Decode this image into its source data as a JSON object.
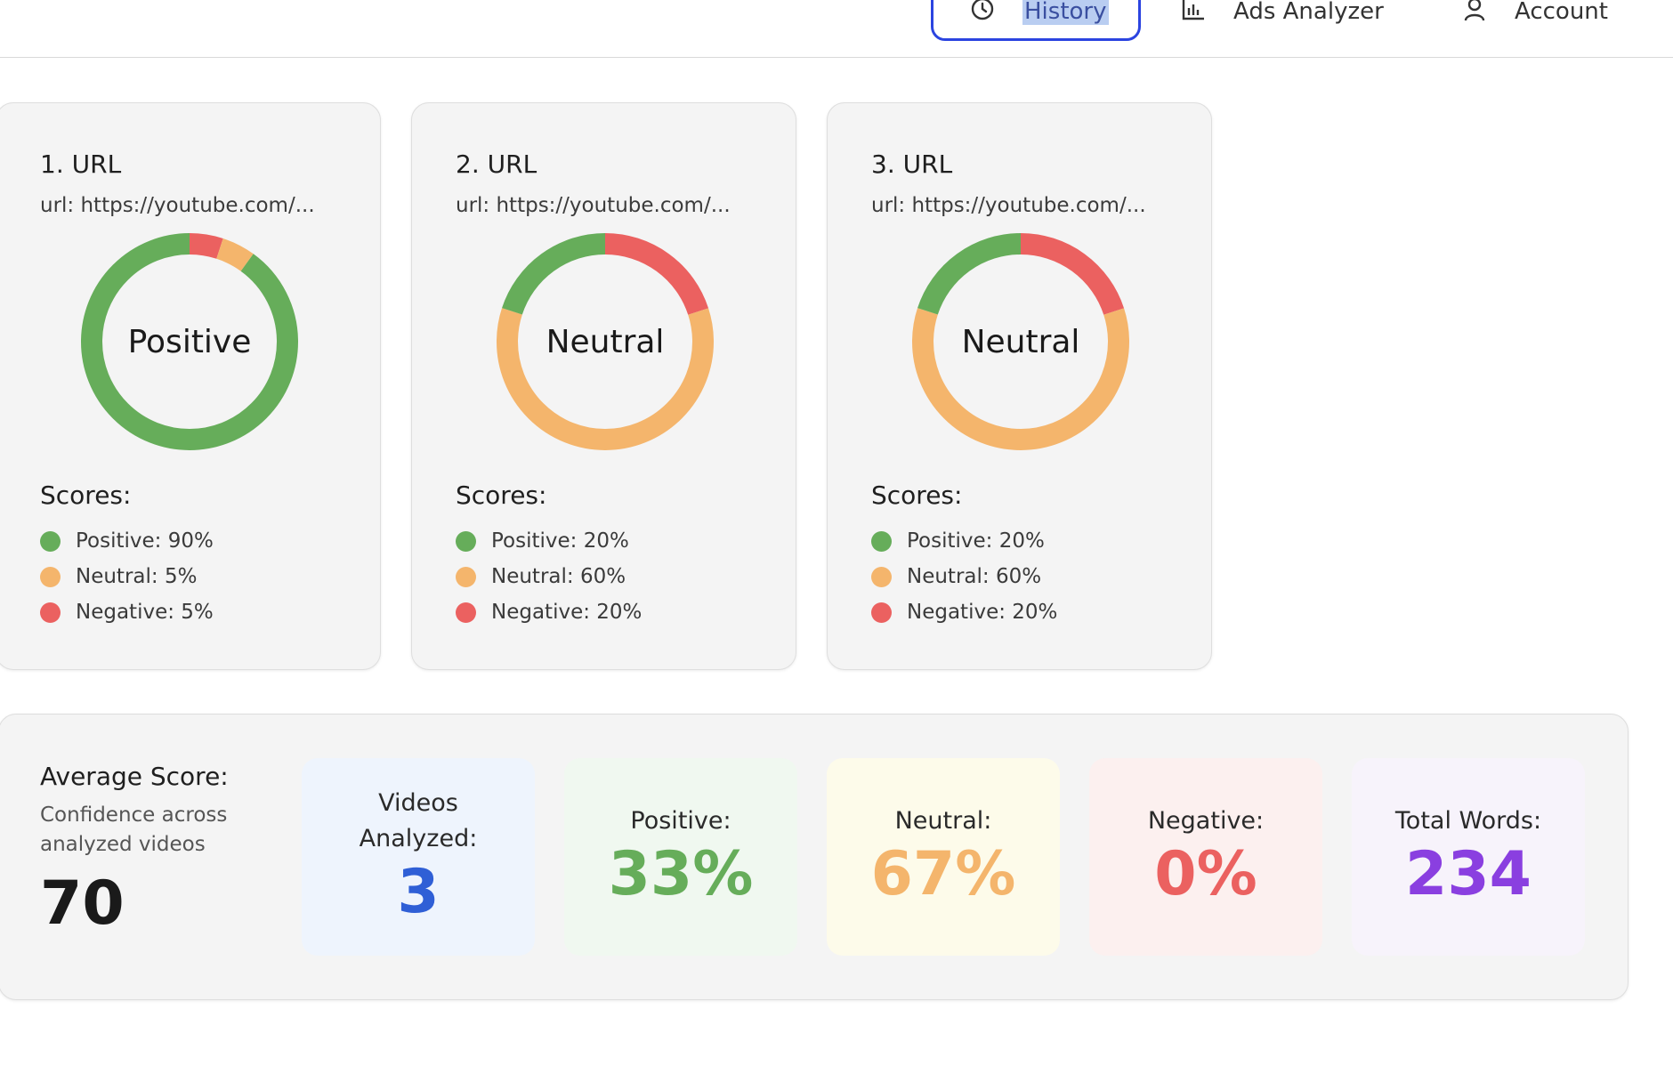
{
  "nav": {
    "history_label": "History",
    "ads_label": "Ads Analyzer",
    "account_label": "Account"
  },
  "colors": {
    "positive": "#66ad5a",
    "neutral": "#f4b56c",
    "negative": "#eb6160",
    "videos_blue": "#2f5fd6",
    "words_purple": "#8a3fe0"
  },
  "cards": [
    {
      "title": "1. URL",
      "url": "url: https://youtube.com/...",
      "center_label": "Positive",
      "scores_title": "Scores:",
      "positive": 90,
      "neutral": 5,
      "negative": 5,
      "positive_label": "Positive: 90%",
      "neutral_label": "Neutral: 5%",
      "negative_label": "Negative: 5%"
    },
    {
      "title": "2. URL",
      "url": "url: https://youtube.com/...",
      "center_label": "Neutral",
      "scores_title": "Scores:",
      "positive": 20,
      "neutral": 60,
      "negative": 20,
      "positive_label": "Positive: 20%",
      "neutral_label": "Neutral: 60%",
      "negative_label": "Negative: 20%"
    },
    {
      "title": "3. URL",
      "url": "url: https://youtube.com/...",
      "center_label": "Neutral",
      "scores_title": "Scores:",
      "positive": 20,
      "neutral": 60,
      "negative": 20,
      "positive_label": "Positive: 20%",
      "neutral_label": "Neutral: 60%",
      "negative_label": "Negative: 20%"
    }
  ],
  "summary": {
    "avg_title": "Average Score:",
    "avg_subtitle": "Confidence across analyzed videos",
    "avg_value": "70",
    "videos_label": "Videos Analyzed:",
    "videos_value": "3",
    "positive_label": "Positive:",
    "positive_value": "33%",
    "neutral_label": "Neutral:",
    "neutral_value": "67%",
    "negative_label": "Negative:",
    "negative_value": "0%",
    "words_label": "Total Words:",
    "words_value": "234"
  }
}
